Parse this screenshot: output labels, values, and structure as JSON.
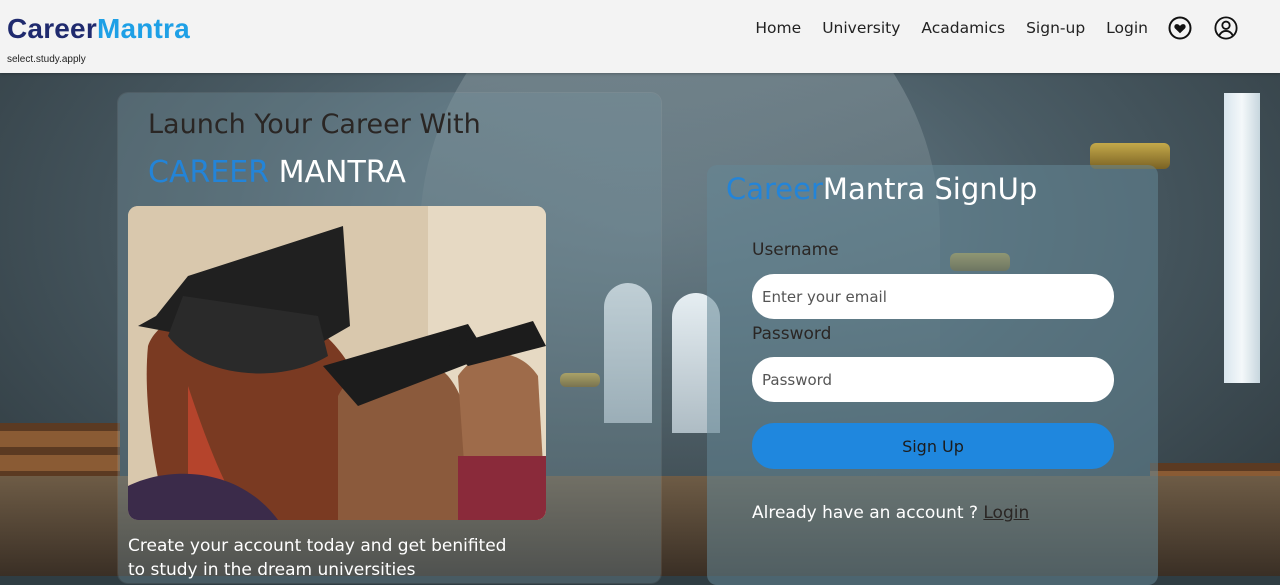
{
  "header": {
    "brand_part1": "Career",
    "brand_part2": "Mantra",
    "tagline": "select.study.apply",
    "nav": {
      "home": "Home",
      "university": "University",
      "academics": "Acadamics",
      "signup": "Sign-up",
      "login": "Login"
    },
    "icons": [
      "heart-icon",
      "user-account-icon"
    ]
  },
  "promo": {
    "title": "Launch Your Career With",
    "brand_part1": "CAREER",
    "brand_part2": "MANTRA",
    "text": "Create your account today and get benifited to study in the dream universities"
  },
  "signup": {
    "title_part1": "Career",
    "title_part2": "Mantra SignUp",
    "username_label": "Username",
    "username_placeholder": "Enter your email",
    "password_label": "Password",
    "password_placeholder": "Password",
    "submit_label": "Sign Up",
    "already_text": "Already have an account ?",
    "login_link": "Login"
  },
  "colors": {
    "brand_dark": "#1f2a6e",
    "brand_light": "#1ea0e6",
    "accent_blue": "#1f87de",
    "header_bg": "#f3f3f3"
  }
}
